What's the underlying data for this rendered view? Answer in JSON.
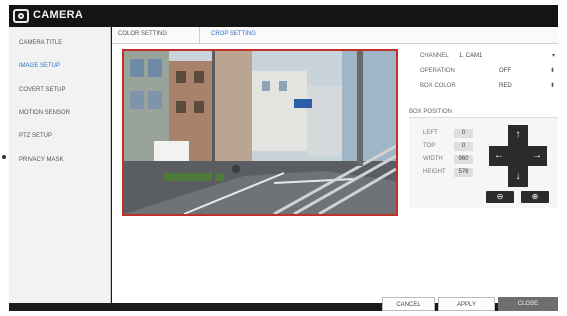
{
  "app": {
    "title": "CAMERA",
    "icon": "camera-icon"
  },
  "sidebar": {
    "items": [
      {
        "label": "CAMERA TITLE",
        "active": false
      },
      {
        "label": "IMAGE SETUP",
        "active": true
      },
      {
        "label": "COVERT SETUP",
        "active": false
      },
      {
        "label": "MOTION SENSOR",
        "active": false
      },
      {
        "label": "PTZ SETUP",
        "active": false
      },
      {
        "label": "PRIVACY MASK",
        "active": false
      }
    ]
  },
  "tabs": [
    {
      "label": "COLOR SETTING",
      "active": false
    },
    {
      "label": "CROP SETTING",
      "active": true
    }
  ],
  "settings": {
    "channel": {
      "label": "CHANNEL",
      "value": "1. CAM1"
    },
    "operation": {
      "label": "OPERATION",
      "value": "OFF"
    },
    "box_color": {
      "label": "BOX COLOR",
      "value": "RED"
    }
  },
  "box_position": {
    "title": "BOX POSITION",
    "left": {
      "label": "LEFT",
      "value": "0"
    },
    "top": {
      "label": "TOP",
      "value": "0"
    },
    "width": {
      "label": "WIDTH",
      "value": "960"
    },
    "height": {
      "label": "HEIGHT",
      "value": "576"
    }
  },
  "buttons": {
    "cancel": "CANCEL",
    "apply": "APPLY",
    "close": "CLOSE"
  },
  "colors": {
    "accent": "#2f6fc4",
    "crop_box": "#c0302b",
    "dark": "#1a1a1a"
  }
}
